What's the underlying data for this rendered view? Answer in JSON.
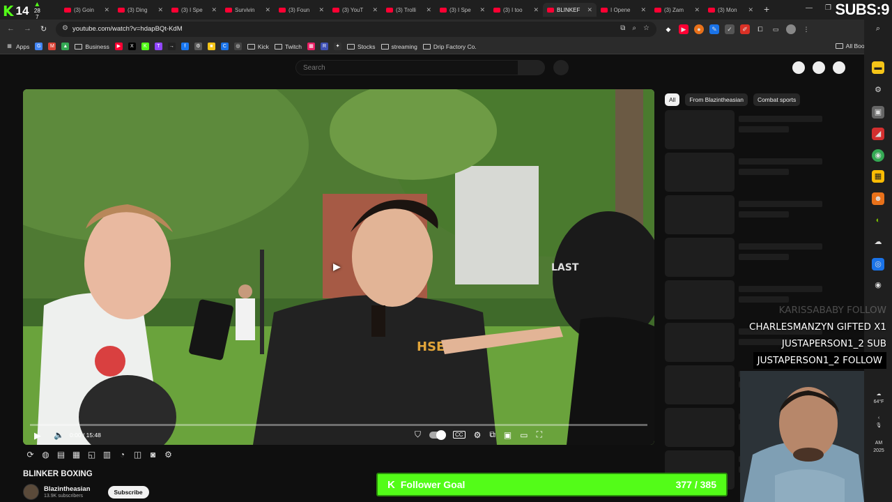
{
  "overlay": {
    "kick_count": "14",
    "kick_up_top": "28",
    "kick_up_bottom": "7",
    "subs_label": "SUBS:9"
  },
  "tabs": [
    {
      "title": "(3) Goin",
      "active": false
    },
    {
      "title": "(3) Ding",
      "active": false
    },
    {
      "title": "(3) I Spe",
      "active": false
    },
    {
      "title": "Survivin",
      "active": false
    },
    {
      "title": "(3) Foun",
      "active": false
    },
    {
      "title": "(3) YouT",
      "active": false
    },
    {
      "title": "(3) Trolli",
      "active": false
    },
    {
      "title": "(3) I Spe",
      "active": false
    },
    {
      "title": "(3) I too",
      "active": false
    },
    {
      "title": "BLINKEF",
      "active": true
    },
    {
      "title": "I Opene",
      "active": false
    },
    {
      "title": "(3) Zam",
      "active": false
    },
    {
      "title": "(3) Mon",
      "active": false
    }
  ],
  "address_bar": {
    "url": "youtube.com/watch?v=hdapBQt-KdM"
  },
  "bookmarks": [
    {
      "label": "Apps",
      "type": "grid"
    },
    {
      "label": "",
      "type": "icon",
      "color": "#4285f4",
      "glyph": "G"
    },
    {
      "label": "",
      "type": "icon",
      "color": "#db4437",
      "glyph": "M"
    },
    {
      "label": "",
      "type": "icon",
      "color": "#34a853",
      "glyph": "▲"
    },
    {
      "label": "Business",
      "type": "folder"
    },
    {
      "label": "",
      "type": "icon",
      "color": "#ff0033",
      "glyph": "▶"
    },
    {
      "label": "",
      "type": "icon",
      "color": "#000000",
      "glyph": "X"
    },
    {
      "label": "",
      "type": "icon",
      "color": "#53fc18",
      "glyph": "K"
    },
    {
      "label": "",
      "type": "icon",
      "color": "#9146ff",
      "glyph": "T"
    },
    {
      "label": "",
      "type": "icon",
      "color": "#222222",
      "glyph": "→"
    },
    {
      "label": "",
      "type": "icon",
      "color": "#1877f2",
      "glyph": "f"
    },
    {
      "label": "",
      "type": "icon",
      "color": "#5a5a5a",
      "glyph": "⚙"
    },
    {
      "label": "",
      "type": "icon",
      "color": "#f5c518",
      "glyph": "■"
    },
    {
      "label": "",
      "type": "icon",
      "color": "#1a73e8",
      "glyph": "C"
    },
    {
      "label": "",
      "type": "icon",
      "color": "#444444",
      "glyph": "◎"
    },
    {
      "label": "Kick",
      "type": "folder"
    },
    {
      "label": "Twitch",
      "type": "folder"
    },
    {
      "label": "",
      "type": "icon",
      "color": "#e91e63",
      "glyph": "▦"
    },
    {
      "label": "",
      "type": "icon",
      "color": "#3f51b5",
      "glyph": "R"
    },
    {
      "label": "",
      "type": "icon",
      "color": "#333333",
      "glyph": "✦"
    },
    {
      "label": "Stocks",
      "type": "folder"
    },
    {
      "label": "streaming",
      "type": "folder"
    },
    {
      "label": "Drip Factory Co.",
      "type": "folder"
    }
  ],
  "all_bookmarks": "All Bookmarks",
  "youtube": {
    "search_placeholder": "Search",
    "chips": [
      {
        "label": "All",
        "selected": true
      },
      {
        "label": "From Blazintheasian",
        "selected": false
      },
      {
        "label": "Combat sports",
        "selected": false
      }
    ],
    "video_time": "0:00 / 15:48",
    "video_title": "BLINKER BOXING",
    "channel_name": "Blazintheasian",
    "channel_subs": "13.9K subscribers",
    "subscribe_label": "Subscribe"
  },
  "stream_alerts": [
    {
      "text": "KARISSABABY  FOLLOW",
      "style": "faded"
    },
    {
      "text": "CHARLESMANZYN  GIFTED X1",
      "style": "normal"
    },
    {
      "text": "JUSTAPERSON1_2  SUB",
      "style": "normal"
    },
    {
      "text": "JUSTAPERSON1_2  FOLLOW",
      "style": "boxed"
    }
  ],
  "follower_goal": {
    "label": "Follower Goal",
    "value": "377 / 385",
    "color": "#53fc18"
  },
  "tray": {
    "temp": "64°F",
    "time": "AM",
    "year": "2025"
  }
}
